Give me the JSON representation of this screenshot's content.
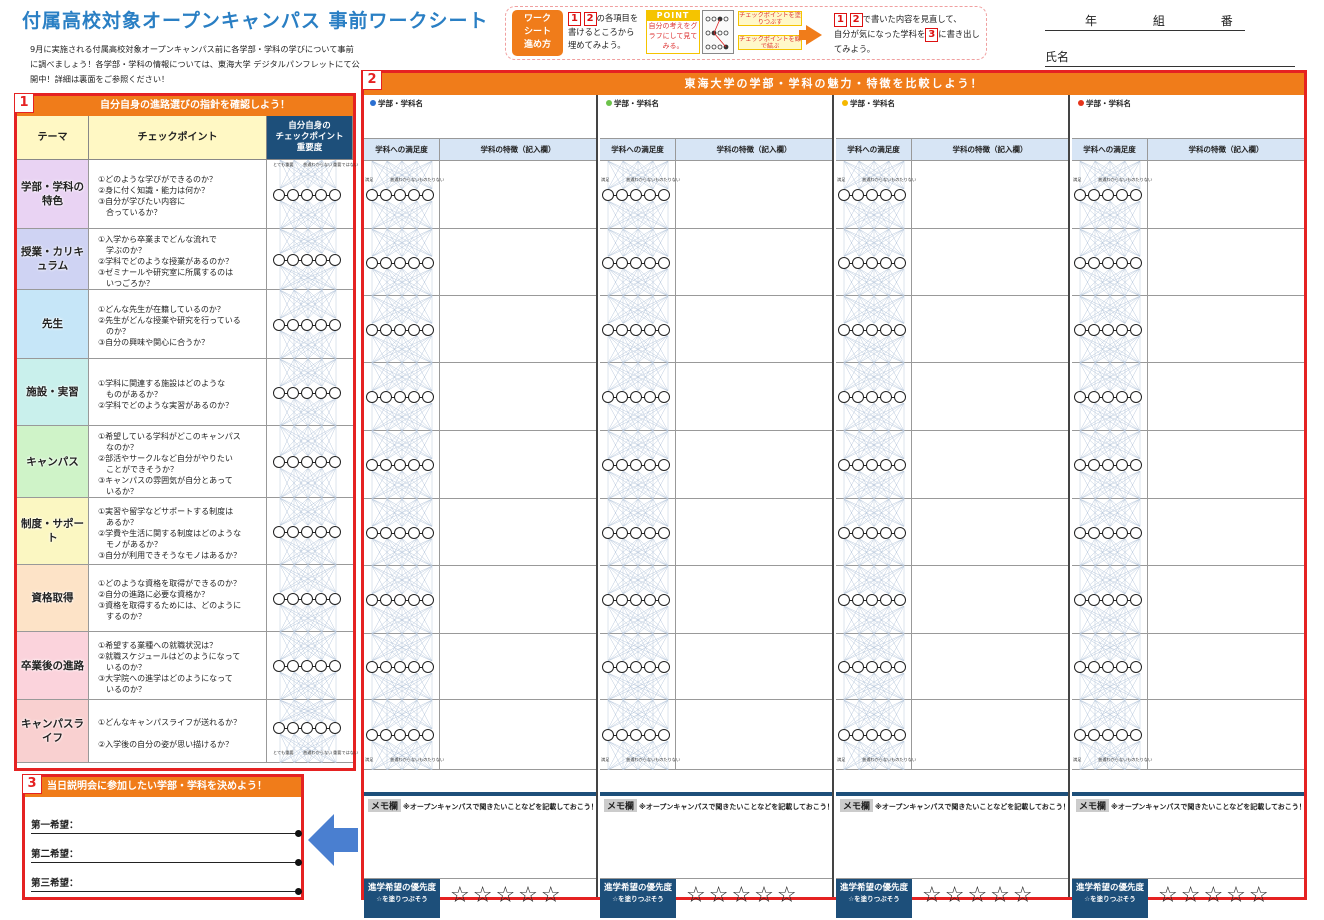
{
  "header": {
    "title": "付属高校対象オープンキャンパス 事前ワークシート",
    "intro": "9月に実施される付属高校対象オープンキャンパス前に各学部・学科の学びについて事前に調べましょう！各学部・学科の情報については、東海大学 デジタルパンフレットにて公開中！詳細は裏面をご参照ください！",
    "year": "年",
    "class": "組",
    "number": "番",
    "name_label": "氏名"
  },
  "instructions": {
    "howto": "ワーク\nシート\n進め方",
    "n1": "1",
    "n2": "2",
    "n3": "3",
    "step1": "の各項目を書けるところから埋めてみよう。",
    "point_title": "POINT",
    "point_text": "自分の考えをグラフにして見てみる。",
    "tag1": "チェックポイントを塗りつぶす",
    "tag2": "チェックポイントを線で結ぶ",
    "step2a": "で書いた内容を見直して、",
    "step2b": "自分が気になった学科を",
    "step2c": "に書き出してみよう。"
  },
  "section1": {
    "num": "1",
    "title": "自分自身の進路選びの指針を確認しよう！",
    "col_theme": "テーマ",
    "col_check": "チェックポイント",
    "col_importance": "自分自身の\nチェックポイント\n重要度",
    "scale_top": [
      "とても重要",
      "普通わからない",
      "重要ではない"
    ],
    "scale_bottom": [
      "とても重要",
      "普通わからない",
      "重要ではない"
    ],
    "rows": [
      {
        "theme": "学部・学科の特色",
        "color": "#e9d3f3",
        "check": "①どのような学びができるのか？\n②身に付く知識・能力は何か？\n③自分が学びたい内容に\n　合っているか？"
      },
      {
        "theme": "授業・カリキュラム",
        "color": "#cfd3f3",
        "check": "①入学から卒業までどんな流れで\n　学ぶのか？\n②学科でどのような授業があるのか？\n③ゼミナールや研究室に所属するのは\n　いつごろか？"
      },
      {
        "theme": "先生",
        "color": "#c6e6f8",
        "check": "①どんな先生が在籍しているのか？\n②先生がどんな授業や研究を行っている\n　のか？\n③自分の興味や関心に合うか？"
      },
      {
        "theme": "施設・実習",
        "color": "#c9f0ec",
        "check": "①学科に関連する施設はどのような\n　ものがあるか？\n②学科でどのような実習があるのか？"
      },
      {
        "theme": "キャンパス",
        "color": "#cff3c8",
        "check": "①希望している学科がどこのキャンパス\n　なのか？\n②部活やサークルなど自分がやりたい\n　ことができそうか？\n③キャンパスの雰囲気が自分とあって\n　いるか？"
      },
      {
        "theme": "制度・サポート",
        "color": "#fbf7c2",
        "check": "①実習や留学などサポートする制度は\n　あるか？\n②学費や生活に関する制度はどのような\n　モノがあるか？\n③自分が利用できそうなモノはあるか？"
      },
      {
        "theme": "資格取得",
        "color": "#fde3c7",
        "check": "①どのような資格を取得ができるのか？\n②自分の進路に必要な資格か？\n③資格を取得するためには、どのように\n　するのか？"
      },
      {
        "theme": "卒業後の進路",
        "color": "#fbd3dc",
        "check": "①希望する業種への就職状況は？\n②就職スケジュールはどのようになって\n　いるのか？\n③大学院への進学はどのようになって\n　いるのか？"
      },
      {
        "theme": "キャンパスライフ",
        "color": "#f9d0d0",
        "check": "①どんなキャンパスライフが送れるか？\n\n②入学後の自分の姿が思い描けるか？"
      }
    ]
  },
  "section2": {
    "num": "2",
    "title": "東海大学の学部・学科の魅力・特徴を比較しよう！",
    "dept_label": "学部・学科名",
    "satisfaction_label": "学科への満足度",
    "feature_label": "学科の特徴（記入欄）",
    "scale_top": [
      "満足",
      "普通わからない",
      "ものたりない"
    ],
    "scale_bottom": [
      "満足",
      "普通わからない",
      "ものたりない"
    ],
    "memo_tag": "メモ欄",
    "memo_text": "※オープンキャンパスで聞きたいことなどを記載しておこう！",
    "priority_label": "進学希望の優先度",
    "priority_sub": "☆を塗りつぶそう",
    "stars": "☆☆☆☆☆",
    "dot_colors": [
      "#2a6fd1",
      "#6cc24a",
      "#f5b800",
      "#e6331a"
    ]
  },
  "section3": {
    "num": "3",
    "title": "当日説明会に参加したい学部・学科を決めよう！",
    "wishes": [
      "第一希望：",
      "第二希望：",
      "第三希望："
    ]
  },
  "colors": {
    "accent": "#f07c1a",
    "frame": "#e52222",
    "navy": "#1d4f7a",
    "title_blue": "#2a7fc4"
  }
}
